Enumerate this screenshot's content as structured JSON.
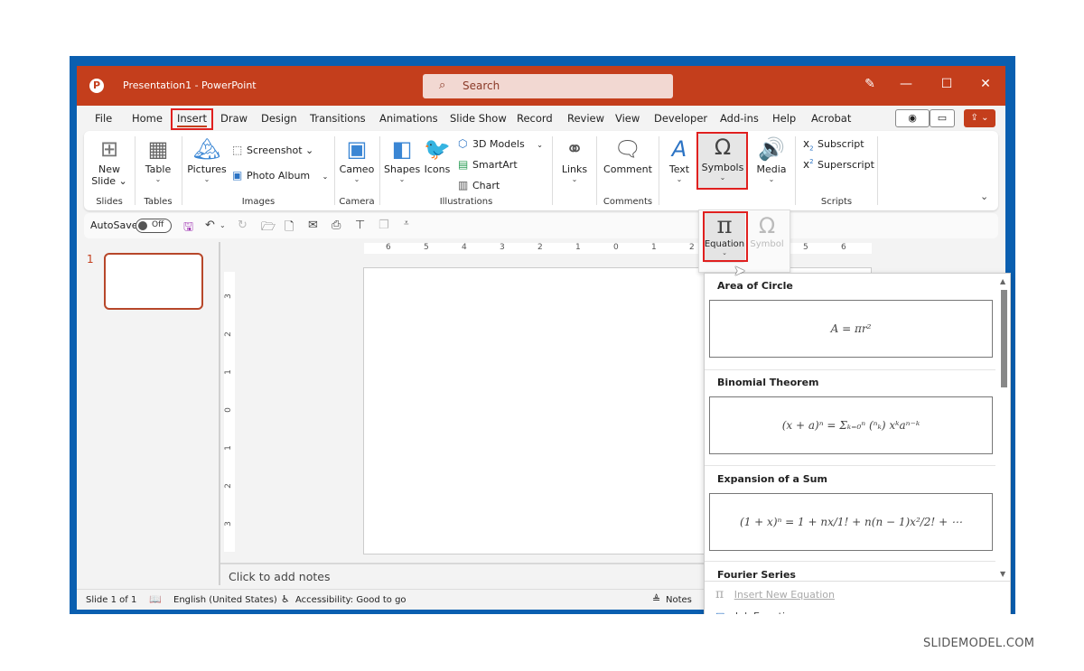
{
  "window": {
    "app_logo": "P",
    "title": "Presentation1  -  PowerPoint",
    "search_icon": "⌕",
    "search_label": "Search",
    "pen_icon": "✎",
    "minimize": "—",
    "maximize": "☐",
    "close": "✕"
  },
  "menu": {
    "items": [
      "File",
      "Home",
      "Insert",
      "Draw",
      "Design",
      "Transitions",
      "Animations",
      "Slide Show",
      "Record",
      "Review",
      "View",
      "Developer",
      "Add-ins",
      "Help",
      "Acrobat"
    ],
    "active": "Insert",
    "record_icon": "◉",
    "comment_icon": "▭",
    "share_icon": "⇪ ⌄"
  },
  "ribbon": {
    "slides": {
      "button": "New\nSlide ⌄",
      "btn_line1": "New",
      "btn_line2": "Slide ⌄",
      "group": "Slides"
    },
    "tables": {
      "button": "Table",
      "group": "Tables"
    },
    "images": {
      "pictures": "Pictures",
      "screenshot": "Screenshot ⌄",
      "photo_album": "Photo Album",
      "group": "Images"
    },
    "camera": {
      "button": "Cameo",
      "group": "Camera"
    },
    "illustrations": {
      "shapes": "Shapes",
      "icons": "Icons",
      "models": "3D Models",
      "smartart": "SmartArt",
      "chart": "Chart",
      "group": "Illustrations"
    },
    "links": {
      "button": "Links"
    },
    "comments": {
      "button": "Comment",
      "group": "Comments"
    },
    "text": {
      "button": "Text"
    },
    "symbols": {
      "button": "Symbols",
      "icon": "Ω"
    },
    "media": {
      "button": "Media"
    },
    "scripts": {
      "subscript": "Subscript",
      "superscript": "Superscript",
      "group": "Scripts"
    },
    "caret": "⌄",
    "collapse": "⌄"
  },
  "qat": {
    "autosave_label": "AutoSave",
    "autosave_state": "Off"
  },
  "thumbnails": {
    "slide_number": "1"
  },
  "rulers": {
    "horizontal": [
      "6",
      "5",
      "4",
      "3",
      "2",
      "1",
      "0",
      "1",
      "2",
      "3",
      "4",
      "5",
      "6"
    ],
    "vertical": [
      "3",
      "2",
      "1",
      "0",
      "1",
      "2",
      "3"
    ]
  },
  "notes": {
    "placeholder": "Click to add notes"
  },
  "status": {
    "slide": "Slide 1 of 1",
    "language": "English (United States)",
    "accessibility": "Accessibility: Good to go",
    "notes": "Notes"
  },
  "symbols_dropdown": {
    "equation": {
      "icon": "π",
      "label": "Equation",
      "caret": "⌄"
    },
    "symbol": {
      "icon": "Ω",
      "label": "Symbol"
    }
  },
  "equations": {
    "items": [
      {
        "title": "Area of Circle",
        "formula": "A = πr²"
      },
      {
        "title": "Binomial Theorem",
        "formula": "(x + a)ⁿ = Σₖ₌₀ⁿ (ⁿₖ) xᵏaⁿ⁻ᵏ"
      },
      {
        "title": "Expansion of a Sum",
        "formula": "(1 + x)ⁿ = 1 + nx/1! + n(n − 1)x²/2! + ⋯"
      },
      {
        "title": "Fourier Series",
        "formula": ""
      }
    ],
    "insert_new": "Insert New Equation",
    "ink_equation": "Ink Equation"
  },
  "watermark": "SLIDEMODEL.COM"
}
